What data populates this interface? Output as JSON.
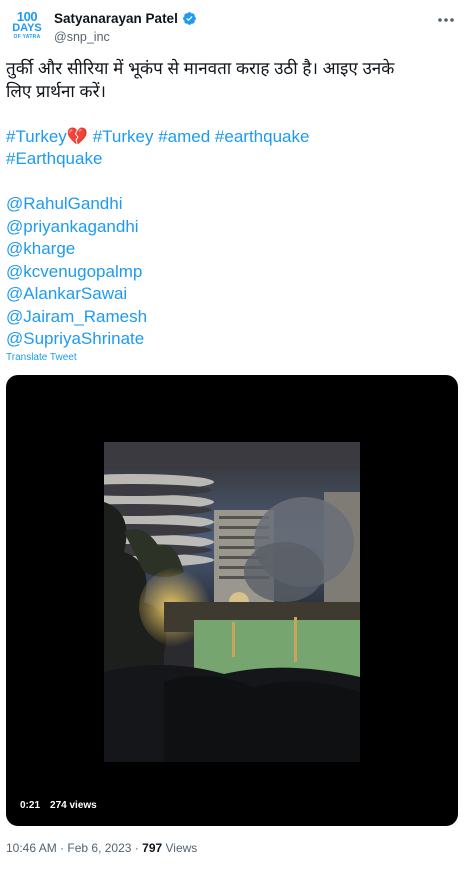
{
  "author": {
    "avatar_text": {
      "line1": "100",
      "line2": "DAYS",
      "line3": "OF YATRA"
    },
    "display_name": "Satyanarayan Patel",
    "handle": "@snp_inc"
  },
  "tweet": {
    "hindi_line1": "तुर्की और सीरिया में भूकंप से मानवता कराह उठी है। आइए उनके",
    "hindi_line2": "लिए प्रार्थना करें।",
    "hashtags": [
      "#Turkey",
      "#Turkey",
      "#amed",
      "#earthquake",
      "#Earthquake"
    ],
    "emoji": "💔",
    "mentions": [
      "@RahulGandhi",
      "@priyankagandhi",
      "@kharge",
      "@kcvenugopalmp",
      "@AlankarSawai",
      "@Jairam_Ramesh",
      "@SupriyaShrinate"
    ]
  },
  "translate_label": "Translate Tweet",
  "video": {
    "duration": "0:21",
    "views": "274 views"
  },
  "footer": {
    "time": "10:46 AM",
    "sep1": "·",
    "date": "Feb 6, 2023",
    "sep2": "·",
    "view_count": "797",
    "views_label": "Views"
  },
  "icons": {
    "verified": "verified-badge-icon",
    "more": "more-options-icon",
    "heart": "broken-heart-emoji"
  },
  "colors": {
    "accent": "#1d9bf0",
    "text": "#0f1419",
    "muted": "#536471",
    "broken_heart": "#d6213a"
  }
}
